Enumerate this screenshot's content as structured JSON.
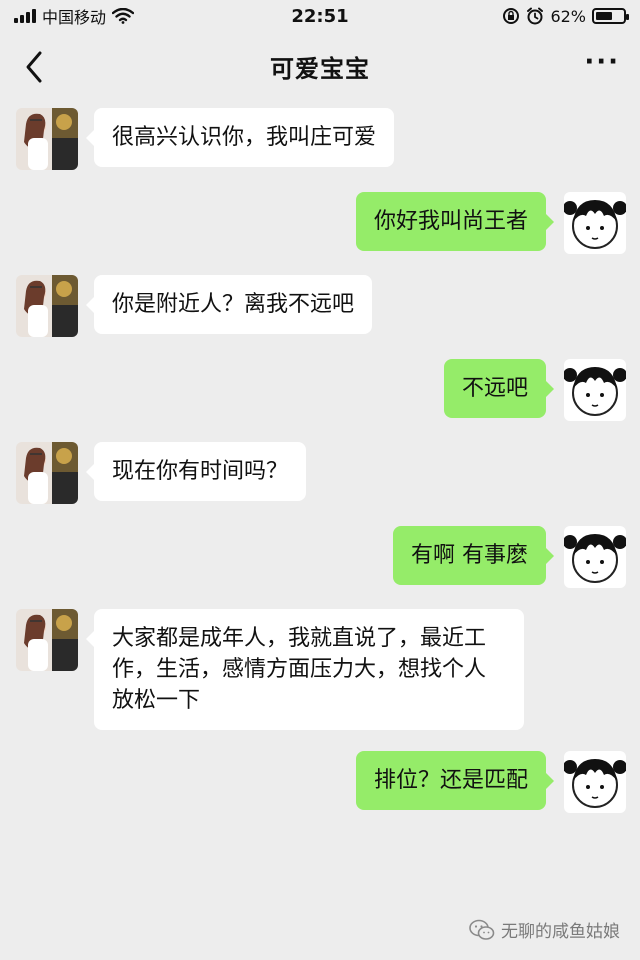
{
  "status_bar": {
    "carrier": "中国移动",
    "time": "22:51",
    "battery_percent_text": "62%",
    "battery_level": 0.62
  },
  "nav": {
    "title": "可爱宝宝",
    "more_label": "···"
  },
  "messages": [
    {
      "side": "left",
      "text": "很高兴认识你，我叫庄可爱"
    },
    {
      "side": "right",
      "text": "你好我叫尚王者"
    },
    {
      "side": "left",
      "text": "你是附近人？离我不远吧"
    },
    {
      "side": "right",
      "text": "不远吧"
    },
    {
      "side": "left",
      "text": "现在你有时间吗？"
    },
    {
      "side": "right",
      "text": "有啊 有事麽"
    },
    {
      "side": "left",
      "text": "大家都是成年人，我就直说了，最近工作，生活，感情方面压力大，想找个人放松一下"
    },
    {
      "side": "right",
      "text": "排位？还是匹配"
    }
  ],
  "watermark": {
    "text": "无聊的咸鱼姑娘",
    "icon": "wechat-icon"
  },
  "colors": {
    "background": "#ededed",
    "incoming_bubble": "#ffffff",
    "outgoing_bubble": "#95ec69"
  }
}
